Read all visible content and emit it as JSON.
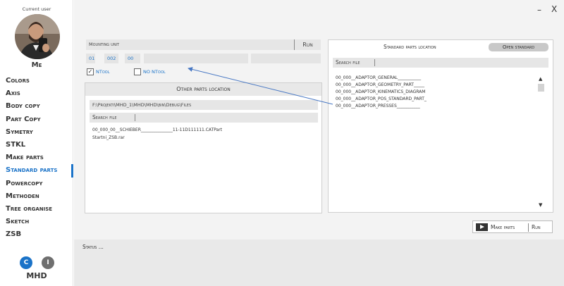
{
  "sidebar": {
    "current_user_label": "Current user",
    "user_name": "Me",
    "menu": [
      {
        "label": "Colors",
        "active": false
      },
      {
        "label": "Axis",
        "active": false
      },
      {
        "label": "Body copy",
        "active": false
      },
      {
        "label": "Part Copy",
        "active": false
      },
      {
        "label": "Symetry",
        "active": false
      },
      {
        "label": "STKL",
        "active": false
      },
      {
        "label": "Make parts",
        "active": false
      },
      {
        "label": "Standard parts",
        "active": true
      },
      {
        "label": "Powercopy",
        "active": false
      },
      {
        "label": "Methoden",
        "active": false
      },
      {
        "label": "Tree organise",
        "active": false
      },
      {
        "label": "Sketch",
        "active": false
      },
      {
        "label": "ZSB",
        "active": false
      }
    ],
    "c_button": "C",
    "i_button": "I",
    "footer_label": "MHD"
  },
  "window": {
    "minimize": "–",
    "close": "X"
  },
  "mounting": {
    "label": "Mounting unit",
    "run_label": "Run",
    "code1": "01",
    "code2": "002",
    "code3": "00",
    "code4": "",
    "code5": ""
  },
  "options": {
    "ntool_label": "NTool",
    "ntool_checked": true,
    "nontool_label": "NO NTool",
    "nontool_checked": false
  },
  "other_parts": {
    "title": "Other parts location",
    "path": "F:\\Projekti\\MHD_1\\MHD\\MHD\\bin\\Debug\\Files",
    "search_label": "Search file",
    "files": [
      "00_000_00__SCHIEBER_______________11-11D111111.CATPart",
      "Startni_ZSB.rar"
    ]
  },
  "standard_parts": {
    "title": "Standard parts location",
    "open_button": "Open standard",
    "search_label": "Search file",
    "items": [
      "00_000__ADAPTOR_GENERAL___________",
      "00_000__ADAPTOR_GEOMETRY_PART_____",
      "00_000__ADAPTOR_KINEMATICS_DIAGRAM",
      "00_000__ADAPTOR_POS_STANDARD_PART_",
      "00_000__ADAPTOR_PRESSES___________"
    ]
  },
  "actions": {
    "make_parts_label": "Make parts",
    "run_label": "Run"
  },
  "status": {
    "text": "Status ..."
  },
  "colors": {
    "accent": "#1b73c8",
    "sidebar_bg": "#ffffff",
    "main_bg": "#f3f3f3",
    "status_bg": "#e9e9e9"
  }
}
